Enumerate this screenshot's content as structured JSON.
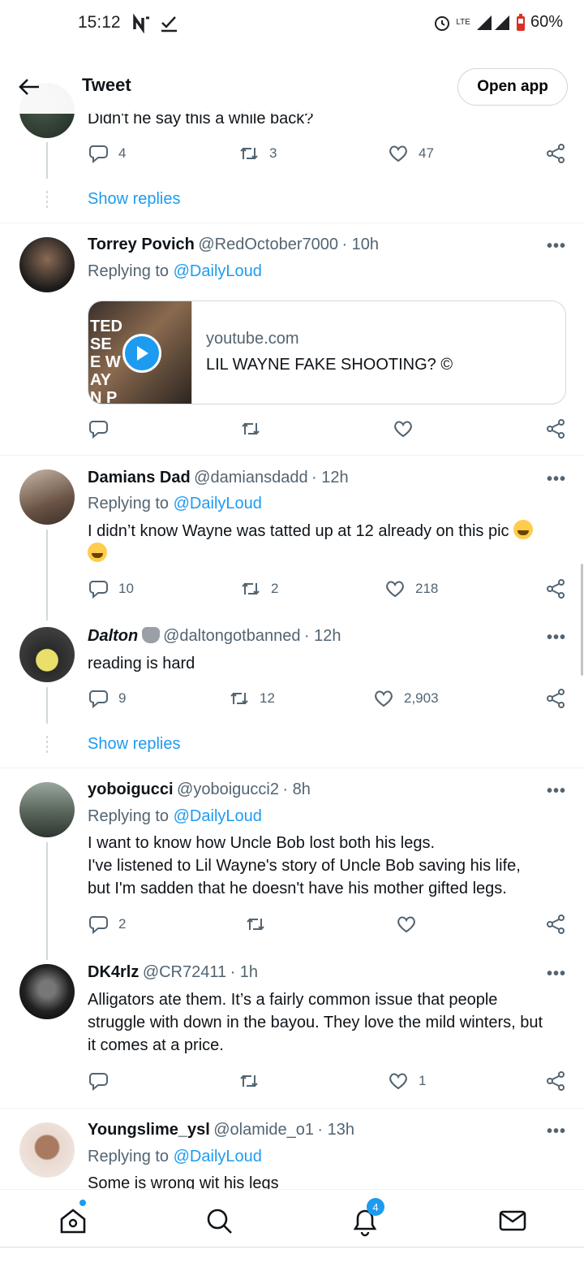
{
  "status_bar": {
    "time": "15:12",
    "battery": "60%",
    "network": "LTE"
  },
  "header": {
    "title": "Tweet",
    "open_app": "Open app"
  },
  "top_partial": {
    "text": "Didn't he say this a while back?",
    "replies": "4",
    "retweets": "3",
    "likes": "47",
    "show_replies": "Show replies"
  },
  "tweets": [
    {
      "name": "Torrey Povich",
      "handle": "@RedOctober7000",
      "time": "· 10h",
      "replying_prefix": "Replying to",
      "replying_to": "@DailyLoud",
      "card": {
        "domain": "youtube.com",
        "title": "LIL WAYNE FAKE SHOOTING? ©",
        "thumb_text": "TED SEE WAYN PTED TING"
      },
      "replies": "",
      "retweets": "",
      "likes": ""
    },
    {
      "name": "Damians Dad",
      "handle": "@damiansdadd",
      "time": "· 12h",
      "replying_prefix": "Replying to",
      "replying_to": "@DailyLoud",
      "text": "I didn’t know Wayne was tatted up at 12 already on this pic",
      "replies": "10",
      "retweets": "2",
      "likes": "218"
    },
    {
      "name": "Dalton",
      "handle": "@daltongotbanned",
      "time": "· 12h",
      "text": "reading is hard",
      "replies": "9",
      "retweets": "12",
      "likes": "2,903",
      "show_replies": "Show replies"
    },
    {
      "name": "yoboigucci",
      "handle": "@yoboigucci2",
      "time": "· 8h",
      "replying_prefix": "Replying to",
      "replying_to": "@DailyLoud",
      "text_lines": [
        "I want to know how Uncle Bob lost both his legs.",
        "I've listened to Lil Wayne's story of Uncle Bob saving his life,",
        "but I'm sadden that he doesn't have his mother gifted legs."
      ],
      "replies": "2",
      "retweets": "",
      "likes": ""
    },
    {
      "name": "DK4rlz",
      "handle": "@CR72411",
      "time": "· 1h",
      "text_lines": [
        "Alligators ate them. It’s a fairly common issue that people",
        "struggle with down in the bayou. They love the mild winters, but",
        "it comes at a price."
      ],
      "replies": "",
      "retweets": "",
      "likes": "1"
    },
    {
      "name": "Youngslime_ysl",
      "handle": "@olamide_o1",
      "time": "· 13h",
      "replying_prefix": "Replying to",
      "replying_to": "@DailyLoud",
      "text": "Some is wrong wit his legs"
    }
  ],
  "nav": {
    "notifications_badge": "4"
  },
  "icons": {
    "more": "more-icon",
    "reply": "reply-icon",
    "retweet": "retweet-icon",
    "like": "heart-icon",
    "share": "share-icon"
  },
  "colors": {
    "accent": "#1d9bf0",
    "muted": "#536471"
  }
}
